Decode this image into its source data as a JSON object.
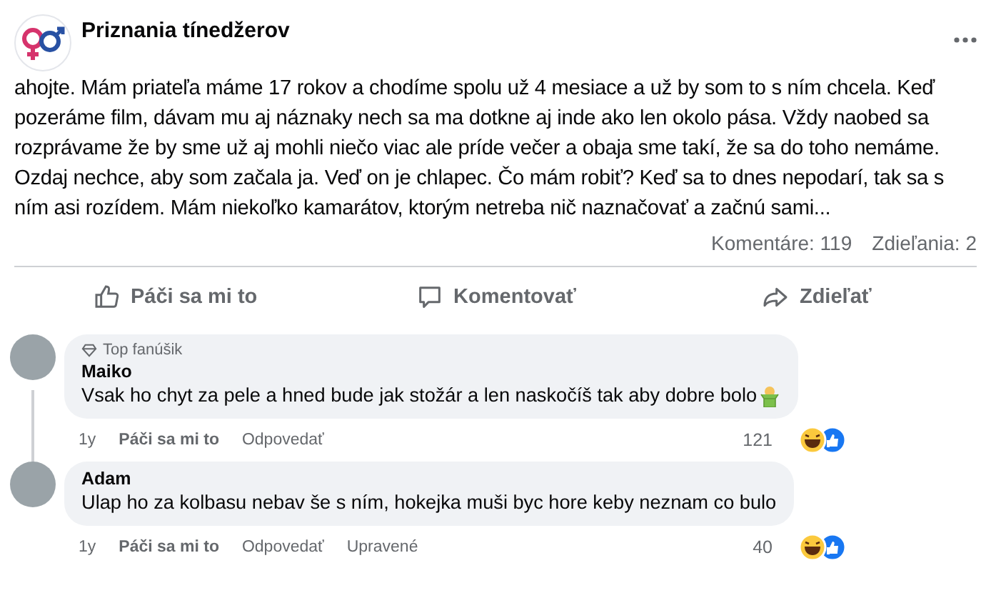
{
  "post": {
    "page_name": "Priznania tínedžerov",
    "text": "ahojte. Mám priateľa máme 17 rokov a chodíme spolu už 4 mesiace a už by som to s ním chcela. Keď pozeráme film, dávam mu aj náznaky nech sa ma dotkne aj inde ako len okolo pása. Vždy naobed sa rozprávame že by sme už aj mohli niečo viac ale príde večer a obaja sme takí, že sa do toho nemáme. Ozdaj nechce, aby som začala ja. Veď on je chlapec. Čo mám robiť? Keď sa to dnes nepodarí, tak sa s ním asi rozídem. Mám niekoľko kamarátov, ktorým netreba nič naznačovať a začnú sami...",
    "comments_count": "Komentáre: 119",
    "shares_count": "Zdieľania: 2"
  },
  "actions": [
    {
      "kind": "like",
      "label": "Páči sa mi to"
    },
    {
      "kind": "comment",
      "label": "Komentovať"
    },
    {
      "kind": "share",
      "label": "Zdieľať"
    }
  ],
  "comments": [
    {
      "badge": "Top fanúšik",
      "author": "Maiko",
      "text": "Vsak ho chyt za pele a hned bude jak stožár a len naskočíš tak aby dobre bolo",
      "emoji": true,
      "time": "1y",
      "like": "Páči sa mi to",
      "reply": "Odpovedať",
      "reactions": "121"
    },
    {
      "author": "Adam",
      "text": "Ulap ho za kolbasu nebav še s ním, hokejka muši byc hore keby neznam co bulo",
      "emoji": false,
      "time": "1y",
      "like": "Páči sa mi to",
      "reply": "Odpovedať",
      "edited": "Upravené",
      "reactions": "40"
    }
  ]
}
